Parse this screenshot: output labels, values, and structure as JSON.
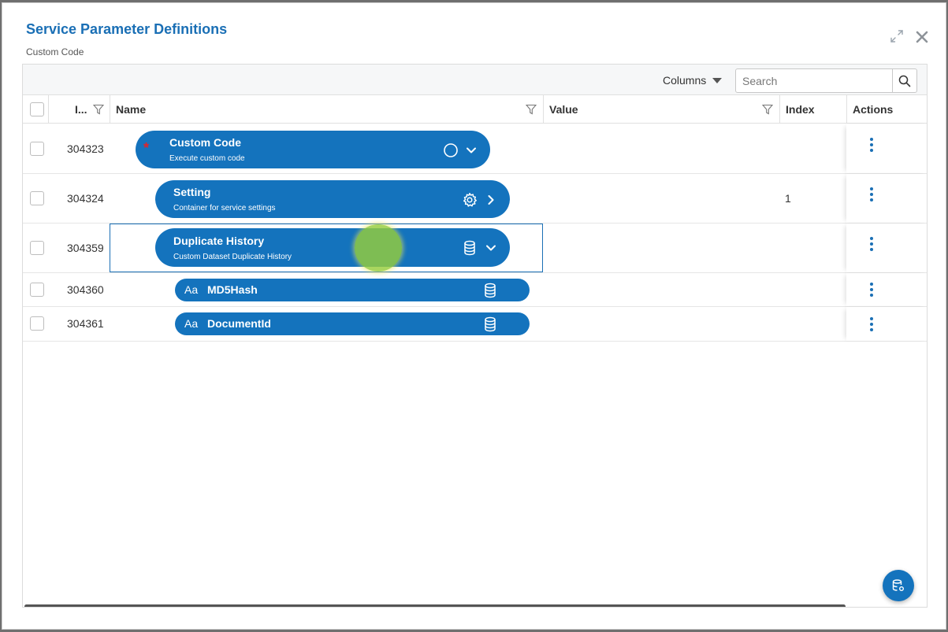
{
  "dialog": {
    "title": "Service Parameter Definitions",
    "subtitle": "Custom Code",
    "icons": {
      "expand": "expand-arrows-icon",
      "close": "close-x-icon"
    }
  },
  "toolbar": {
    "columns_label": "Columns",
    "search_placeholder": "Search",
    "search_value": ""
  },
  "headers": {
    "id": "I...",
    "name": "Name",
    "value": "Value",
    "index": "Index",
    "actions": "Actions"
  },
  "rows": [
    {
      "id": "304323",
      "title": "Custom Code",
      "description": "Execute custom code",
      "index": "",
      "required": "*",
      "icon": "circle-icon",
      "toggle": "chevron-down-icon"
    },
    {
      "id": "304324",
      "title": "Setting",
      "description": "Container for service settings",
      "index": "1",
      "icon": "gear-icon",
      "toggle": "chevron-right-icon"
    },
    {
      "id": "304359",
      "title": "Duplicate History",
      "description": "Custom Dataset Duplicate History",
      "index": "",
      "icon": "database-icon",
      "toggle": "chevron-down-icon"
    },
    {
      "id": "304360",
      "type": "Aa",
      "title": "MD5Hash",
      "index": "",
      "icon": "database-icon"
    },
    {
      "id": "304361",
      "type": "Aa",
      "title": "DocumentId",
      "index": "",
      "icon": "database-icon"
    }
  ],
  "colors": {
    "accent": "#1a6fb5",
    "pill": "#1473bd",
    "required": "#e0242b"
  }
}
